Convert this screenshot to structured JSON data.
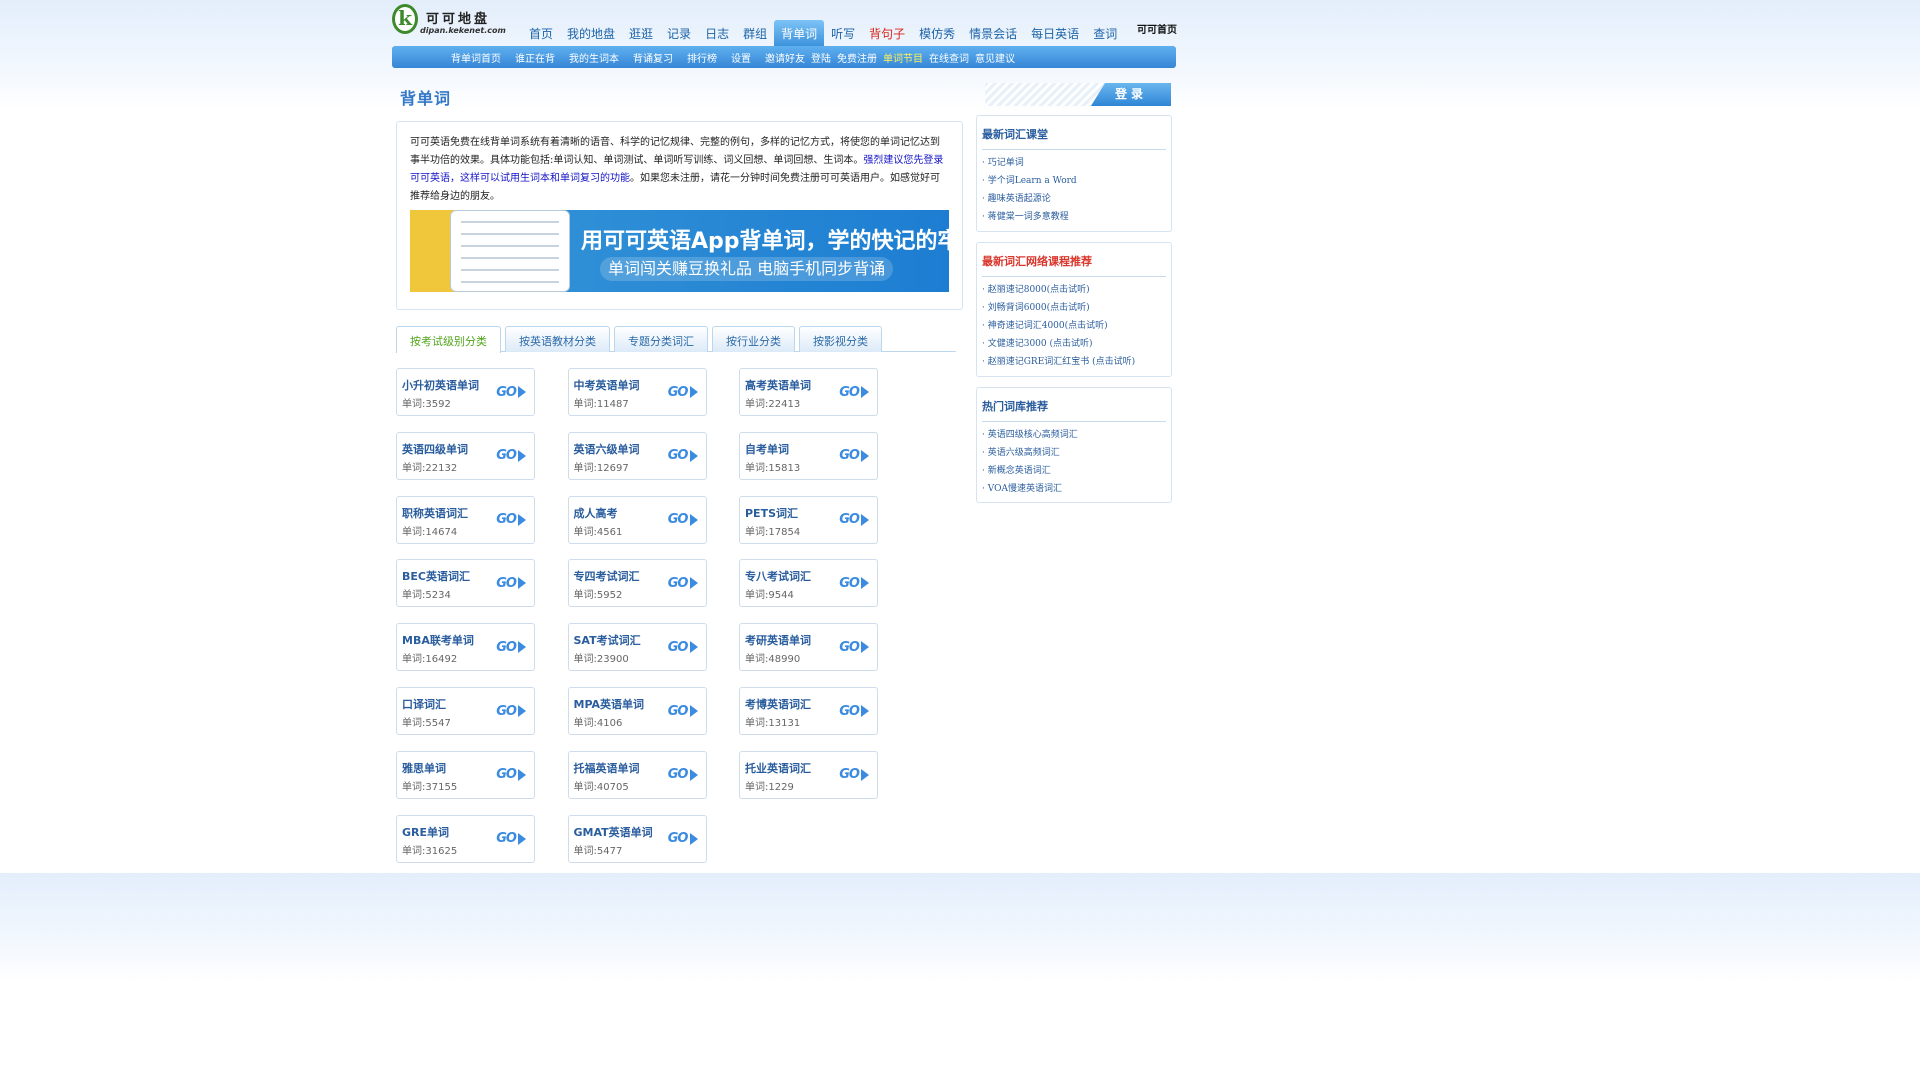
{
  "logo": {
    "title": "可可地盘",
    "sub": "dipan.kekenet.com"
  },
  "topnav": [
    {
      "label": "首页",
      "active": false,
      "red": false
    },
    {
      "label": "我的地盘",
      "active": false,
      "red": false
    },
    {
      "label": "逛逛",
      "active": false,
      "red": false
    },
    {
      "label": "记录",
      "active": false,
      "red": false
    },
    {
      "label": "日志",
      "active": false,
      "red": false
    },
    {
      "label": "群组",
      "active": false,
      "red": false
    },
    {
      "label": "背单词",
      "active": true,
      "red": false
    },
    {
      "label": "听写",
      "active": false,
      "red": false
    },
    {
      "label": "背句子",
      "active": false,
      "red": true
    },
    {
      "label": "模仿秀",
      "active": false,
      "red": false
    },
    {
      "label": "情景会话",
      "active": false,
      "red": false
    },
    {
      "label": "每日英语",
      "active": false,
      "red": false
    },
    {
      "label": "查词",
      "active": false,
      "red": false
    }
  ],
  "home_link": "可可首页",
  "subnav": [
    {
      "label": "背单词首页",
      "hl": false,
      "tight": false
    },
    {
      "label": "谁正在背",
      "hl": false,
      "tight": false
    },
    {
      "label": "我的生词本",
      "hl": false,
      "tight": false
    },
    {
      "label": "背诵复习",
      "hl": false,
      "tight": false
    },
    {
      "label": "排行榜",
      "hl": false,
      "tight": false
    },
    {
      "label": "设置",
      "hl": false,
      "tight": false
    },
    {
      "label": "邀请好友",
      "hl": false,
      "tight": true
    },
    {
      "label": "登陆",
      "hl": false,
      "tight": true
    },
    {
      "label": "免费注册",
      "hl": false,
      "tight": true
    },
    {
      "label": "单词节目",
      "hl": true,
      "tight": true
    },
    {
      "label": "在线查词",
      "hl": false,
      "tight": true
    },
    {
      "label": "意见建议",
      "hl": false,
      "tight": true
    }
  ],
  "page_title": "背单词",
  "intro": {
    "text1": "可可英语免费在线背单词系统有着清晰的语音、科学的记忆规律、完整的例句，多样的记忆方式，将使您的单词记忆达到事半功倍的效果。具体功能包括:单词认知、单词测试、单词听写训练、词义回想、单词回想、生词本。",
    "text_blue": "强烈建议您先登录可可英语，这样可以试用生词本和单词复习的功能",
    "text2": "。如果您未注册，请花一分钟时间免费注册可可英语用户。如感觉好可推荐给身边的朋友。"
  },
  "banner": {
    "headline": "用可可英语App背单词，学的快记的牢！",
    "sub": "单词闯关赚豆换礼品 电脑手机同步背诵"
  },
  "tabs": [
    {
      "label": "按考试级别分类",
      "active": true
    },
    {
      "label": "按英语教材分类",
      "active": false
    },
    {
      "label": "专题分类词汇",
      "active": false
    },
    {
      "label": "按行业分类",
      "active": false
    },
    {
      "label": "按影视分类",
      "active": false
    }
  ],
  "go_label": "GO",
  "cards": [
    {
      "name": "小升初英语单词",
      "count": "单词:3592"
    },
    {
      "name": "中考英语单词",
      "count": "单词:11487"
    },
    {
      "name": "高考英语单词",
      "count": "单词:22413"
    },
    {
      "name": "英语四级单词",
      "count": "单词:22132"
    },
    {
      "name": "英语六级单词",
      "count": "单词:12697"
    },
    {
      "name": "自考单词",
      "count": "单词:15813"
    },
    {
      "name": "职称英语词汇",
      "count": "单词:14674"
    },
    {
      "name": "成人高考",
      "count": "单词:4561"
    },
    {
      "name": "PETS词汇",
      "count": "单词:17854"
    },
    {
      "name": "BEC英语词汇",
      "count": "单词:5234"
    },
    {
      "name": "专四考试词汇",
      "count": "单词:5952"
    },
    {
      "name": "专八考试词汇",
      "count": "单词:9544"
    },
    {
      "name": "MBA联考单词",
      "count": "单词:16492"
    },
    {
      "name": "SAT考试词汇",
      "count": "单词:23900"
    },
    {
      "name": "考研英语单词",
      "count": "单词:48990"
    },
    {
      "name": "口译词汇",
      "count": "单词:5547"
    },
    {
      "name": "MPA英语单词",
      "count": "单词:4106"
    },
    {
      "name": "考博英语词汇",
      "count": "单词:13131"
    },
    {
      "name": "雅思单词",
      "count": "单词:37155"
    },
    {
      "name": "托福英语单词",
      "count": "单词:40705"
    },
    {
      "name": "托业英语词汇",
      "count": "单词:1229"
    },
    {
      "name": "GRE单词",
      "count": "单词:31625"
    },
    {
      "name": "GMAT英语单词",
      "count": "单词:5477"
    }
  ],
  "login_label": "登录",
  "side": {
    "box1": {
      "title": "最新词汇课堂",
      "items": [
        "· 巧记单词",
        "· 学个词Learn a Word",
        "· 趣味英语起源论",
        "· 蒋健棠一词多意教程"
      ]
    },
    "box2": {
      "title": "最新词汇网络课程推荐",
      "items": [
        "· 赵丽速记8000(点击试听)",
        "· 刘畅背词6000(点击试听)",
        "· 神奇速记词汇4000(点击试听)",
        "· 文健速记3000 (点击试听)",
        "· 赵丽速记GRE词汇红宝书 (点击试听)"
      ]
    },
    "box3": {
      "title": "热门词库推荐",
      "items": [
        "· 英语四级核心高频词汇",
        "· 英语六级高频词汇",
        "· 新概念英语词汇",
        "· VOA慢速英语词汇"
      ]
    }
  },
  "colors": {
    "brand_blue": "#3586d6",
    "link_blue": "#2a5d9e",
    "accent_red": "#d9261c",
    "tab_active_green": "#52a51c",
    "highlight_yellow": "#fff35c"
  }
}
